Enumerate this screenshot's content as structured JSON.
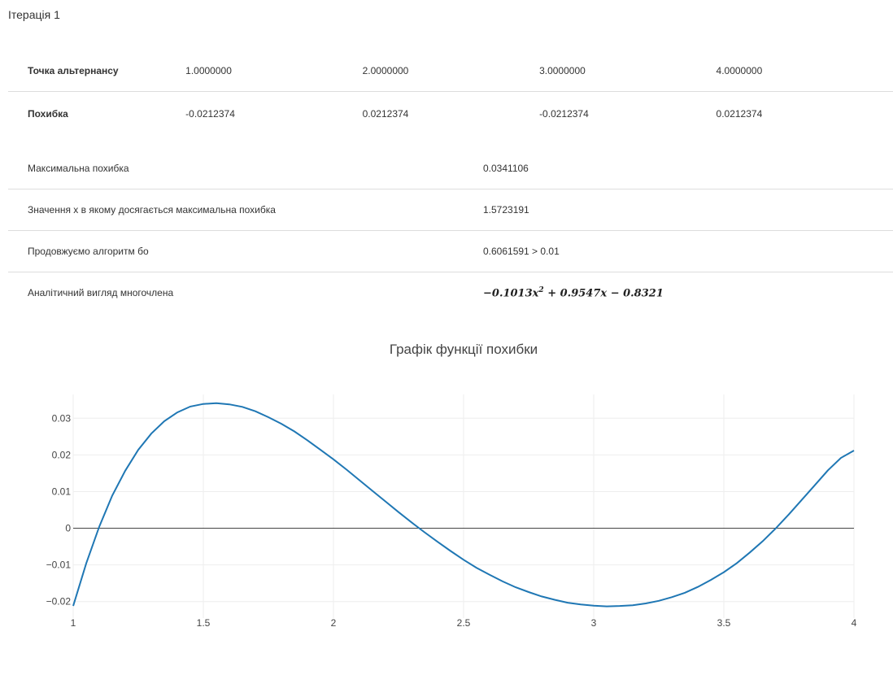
{
  "iteration": {
    "title": "Ітерація 1"
  },
  "alternance_table": {
    "points_label": "Точка альтернансу",
    "points": [
      "1.0000000",
      "2.0000000",
      "3.0000000",
      "4.0000000"
    ],
    "errors_label": "Похибка",
    "errors": [
      "-0.0212374",
      "0.0212374",
      "-0.0212374",
      "0.0212374"
    ]
  },
  "summary": [
    {
      "label": "Максимальна похибка",
      "value": "0.0341106"
    },
    {
      "label": "Значення x в якому досягається максимальна похибка",
      "value": "1.5723191"
    },
    {
      "label": "Продовжуємо алгоритм бо",
      "value": "0.6061591 > 0.01"
    },
    {
      "label": "Аналітичний вигляд многочлена",
      "value": ""
    }
  ],
  "polynomial": {
    "c2": "−0.1013",
    "var1": "x",
    "exp": "2",
    "c1": "+ 0.9547",
    "var2": "x",
    "c0": "− 0.8321"
  },
  "chart_data": {
    "type": "line",
    "title": "Графік функції похибки",
    "xlim": [
      1,
      4
    ],
    "ylim": [
      -0.0245,
      0.0365
    ],
    "xticks": [
      1,
      1.5,
      2,
      2.5,
      3,
      3.5,
      4
    ],
    "xtick_labels": [
      "1",
      "1.5",
      "2",
      "2.5",
      "3",
      "3.5",
      "4"
    ],
    "yticks": [
      -0.02,
      -0.01,
      0,
      0.01,
      0.02,
      0.03
    ],
    "ytick_labels": [
      "−0.02",
      "−0.01",
      "0",
      "0.01",
      "0.02",
      "0.03"
    ],
    "grid": true,
    "zero_line": true,
    "line_color": "#1f77b4",
    "series": [
      {
        "x": [
          1,
          1.05,
          1.1,
          1.15,
          1.2,
          1.25,
          1.3,
          1.35,
          1.4,
          1.45,
          1.5,
          1.55,
          1.6,
          1.65,
          1.7,
          1.75,
          1.8,
          1.85,
          1.9,
          1.95,
          2,
          2.05,
          2.1,
          2.15,
          2.2,
          2.25,
          2.3,
          2.35,
          2.4,
          2.45,
          2.5,
          2.55,
          2.6,
          2.65,
          2.7,
          2.75,
          2.8,
          2.85,
          2.9,
          2.95,
          3,
          3.05,
          3.1,
          3.15,
          3.2,
          3.25,
          3.3,
          3.35,
          3.4,
          3.45,
          3.5,
          3.55,
          3.6,
          3.65,
          3.7,
          3.75,
          3.8,
          3.85,
          3.9,
          3.95,
          4
        ],
        "y": [
          -0.0212,
          -0.0096,
          0.0004,
          0.0089,
          0.0157,
          0.0214,
          0.0258,
          0.0292,
          0.0316,
          0.0332,
          0.0339,
          0.0341,
          0.0338,
          0.0331,
          0.0319,
          0.0303,
          0.0285,
          0.0264,
          0.024,
          0.0214,
          0.0188,
          0.016,
          0.0131,
          0.0102,
          0.0073,
          0.0044,
          0.0016,
          -0.0011,
          -0.0037,
          -0.0062,
          -0.0086,
          -0.0108,
          -0.0127,
          -0.0145,
          -0.0161,
          -0.0174,
          -0.0186,
          -0.0195,
          -0.0203,
          -0.0208,
          -0.0211,
          -0.0213,
          -0.0212,
          -0.021,
          -0.0205,
          -0.0198,
          -0.0188,
          -0.0176,
          -0.016,
          -0.0141,
          -0.012,
          -0.0095,
          -0.0066,
          -0.0035,
          0.0,
          0.0038,
          0.0078,
          0.0118,
          0.0158,
          0.0192,
          0.0212
        ]
      }
    ]
  }
}
